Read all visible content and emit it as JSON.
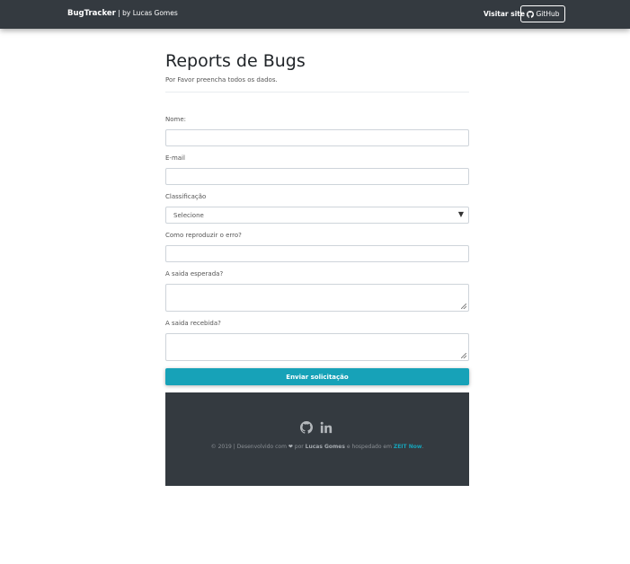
{
  "navbar": {
    "brand_prefix": "Bug",
    "brand_strong": "Tracker",
    "brand_by": " | by Lucas Gomes",
    "visit_site": "Visitar site",
    "github_label": "GitHub"
  },
  "header": {
    "title": "Reports de Bugs",
    "subtitle": "Por Favor preencha todos os dados."
  },
  "form": {
    "name_label": "Nome:",
    "email_label": "E-mail",
    "classification_label": "Classificação",
    "classification_value": "Selecione",
    "reproduce_label": "Como reproduzir o erro?",
    "expected_label": "A saida esperada?",
    "received_label": "A saida recebida?",
    "submit_label": "Enviar solicitação"
  },
  "footer": {
    "text_1": "© 2019 | Desenvolvido com ",
    "heart": "❤",
    "text_2": " por ",
    "author": "Lucas Gomes",
    "text_3": " e hospedado em ",
    "host": "ZEIT Now",
    "text_4": "."
  },
  "colors": {
    "navbar": "#343a40",
    "accent": "#17a2b8",
    "footer": "#343a40"
  }
}
